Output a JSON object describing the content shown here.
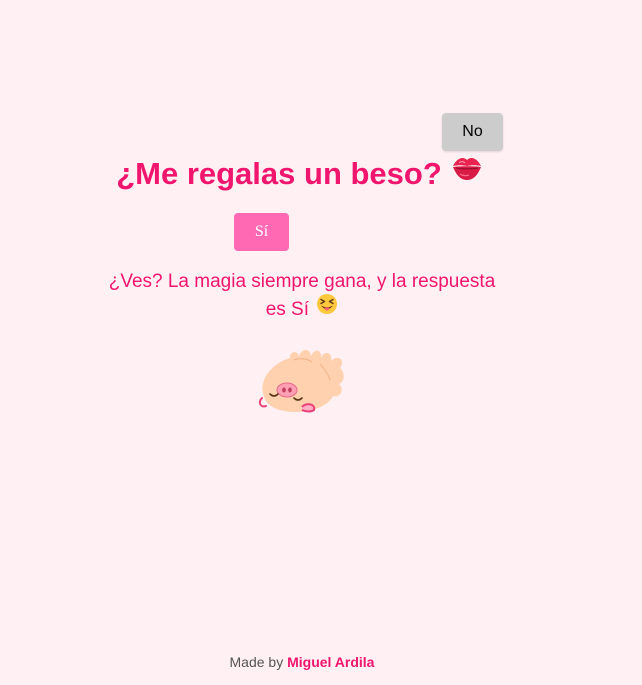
{
  "buttons": {
    "no_label": "No",
    "yes_label": "Sí"
  },
  "question": {
    "text": "¿Me regalas un beso?",
    "icon": "kiss-mark-icon"
  },
  "message": {
    "text": "¿Ves? La magia siempre gana, y la respuesta es Sí",
    "icon": "squinting-tongue-face-icon"
  },
  "illustration": {
    "icon": "sleeping-pig-icon"
  },
  "footer": {
    "prefix": "Made by",
    "author": "Miguel Ardila"
  },
  "colors": {
    "background": "#fff0f3",
    "accent": "#f0156d",
    "yes_button": "#ff69b4",
    "no_button": "#cccccc"
  }
}
